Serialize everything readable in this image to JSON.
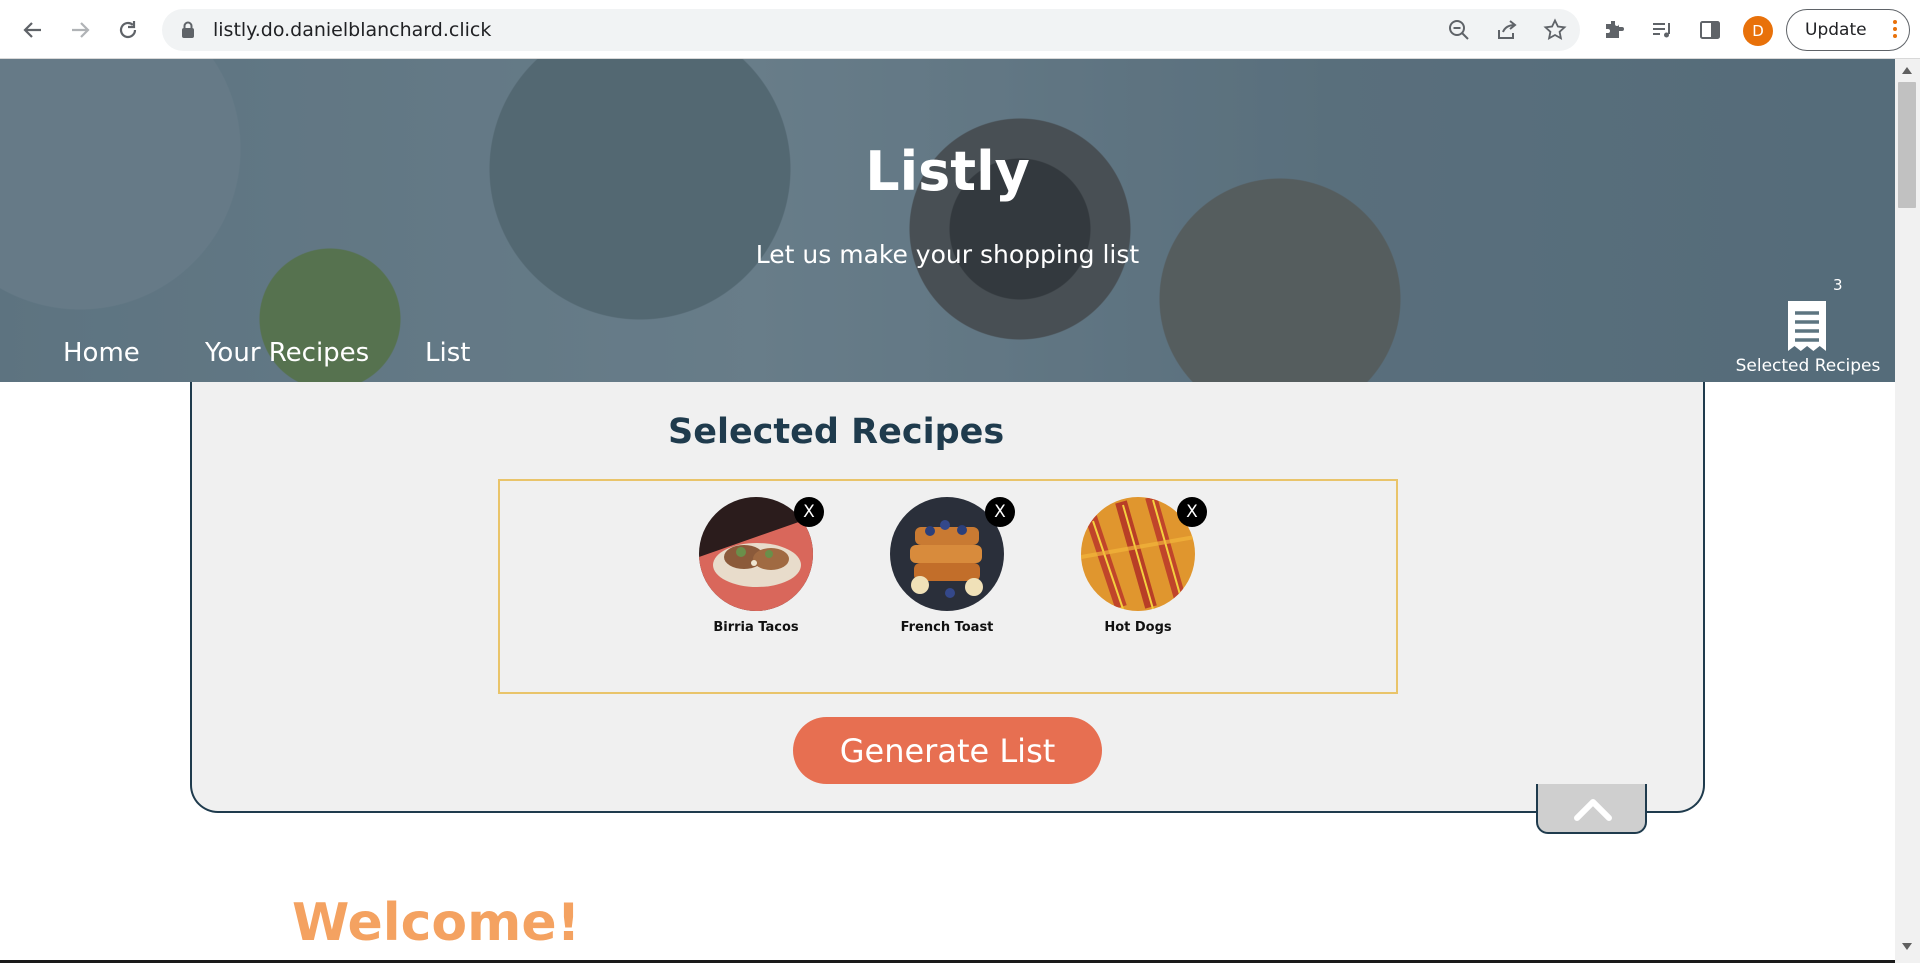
{
  "browser": {
    "url": "listly.do.danielblanchard.click",
    "avatar_letter": "D",
    "update_label": "Update",
    "icons": [
      "back-icon",
      "forward-icon",
      "reload-icon",
      "lock-icon",
      "zoom-out-icon",
      "share-icon",
      "star-icon",
      "extensions-icon",
      "media-icon",
      "side-panel-icon",
      "menu-icon"
    ],
    "accent_color": "#e8710a"
  },
  "hero": {
    "title": "Listly",
    "subtitle": "Let us make your shopping list",
    "nav": [
      {
        "label": "Home"
      },
      {
        "label": "Your Recipes"
      },
      {
        "label": "List"
      }
    ],
    "cart": {
      "count": "3",
      "label": "Selected Recipes",
      "icon": "receipt-icon"
    }
  },
  "selected": {
    "title": "Selected Recipes",
    "recipes": [
      {
        "name": "Birria Tacos",
        "remove_label": "X"
      },
      {
        "name": "French Toast",
        "remove_label": "X"
      },
      {
        "name": "Hot Dogs",
        "remove_label": "X"
      }
    ],
    "generate_label": "Generate List",
    "collapse_icon": "chevron-up-icon"
  },
  "welcome": {
    "heading": "Welcome!"
  },
  "colors": {
    "navy": "#1f3b4d",
    "coral": "#e76f51",
    "gold": "#e9c46a",
    "orange": "#f4a261",
    "panel_bg": "#f0f0f0"
  }
}
